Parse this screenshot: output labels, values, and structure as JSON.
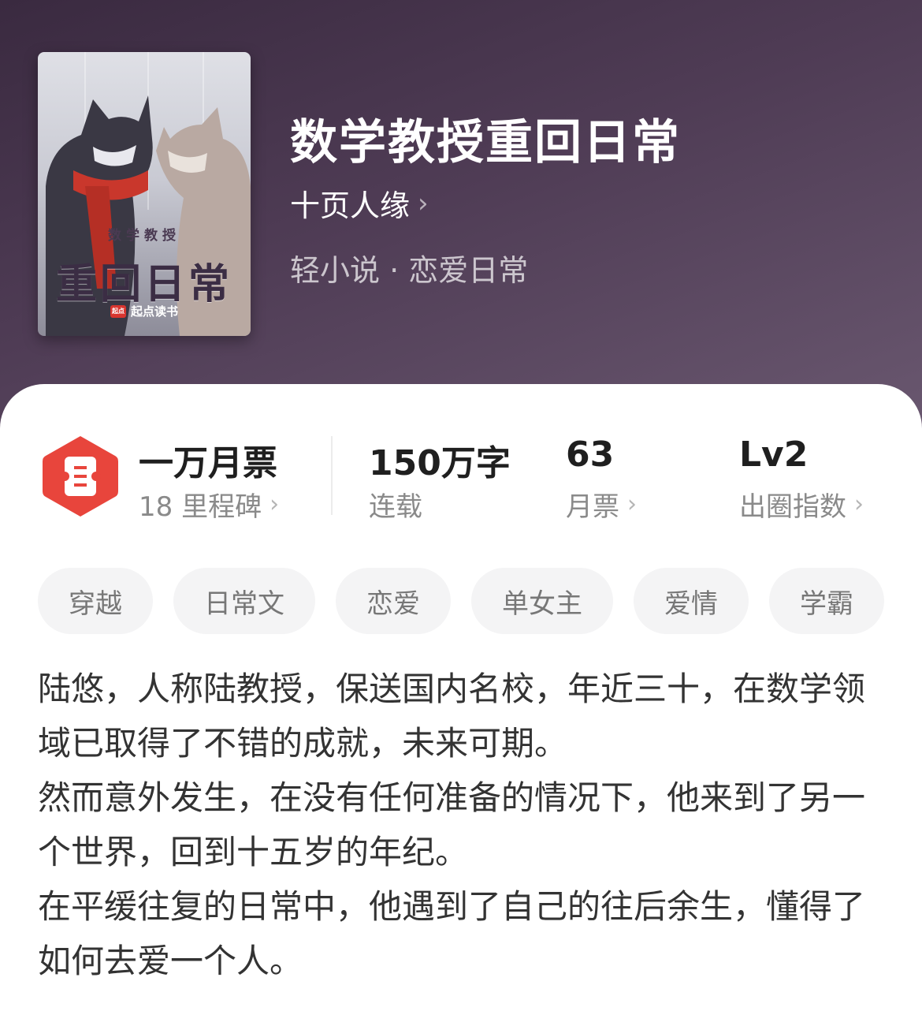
{
  "book": {
    "title": "数学教授重回日常",
    "author": "十页人缘",
    "genre": "轻小说 · 恋爱日常",
    "cover": {
      "subtitle": "数学教授",
      "title": "重回日常",
      "publisher": "起点读书",
      "publisher_logo_text": "起点"
    }
  },
  "stats": {
    "badge_icon": "ticket-icon",
    "milestone_title": "一万月票",
    "milestone_sub": "18 里程碑",
    "words_value": "150万字",
    "words_label": "连载",
    "votes_value": "63",
    "votes_label": "月票",
    "level_value": "Lv2",
    "level_label": "出圈指数",
    "accent_color": "#e8453c"
  },
  "tags": [
    "穿越",
    "日常文",
    "恋爱",
    "单女主",
    "爱情",
    "学霸"
  ],
  "description": [
    "陆悠，人称陆教授，保送国内名校，年近三十，在数学领域已取得了不错的成就，未来可期。",
    "然而意外发生，在没有任何准备的情况下，他来到了另一个世界，回到十五岁的年纪。",
    "在平缓往复的日常中，他遇到了自己的往后余生，懂得了如何去爱一个人。"
  ]
}
